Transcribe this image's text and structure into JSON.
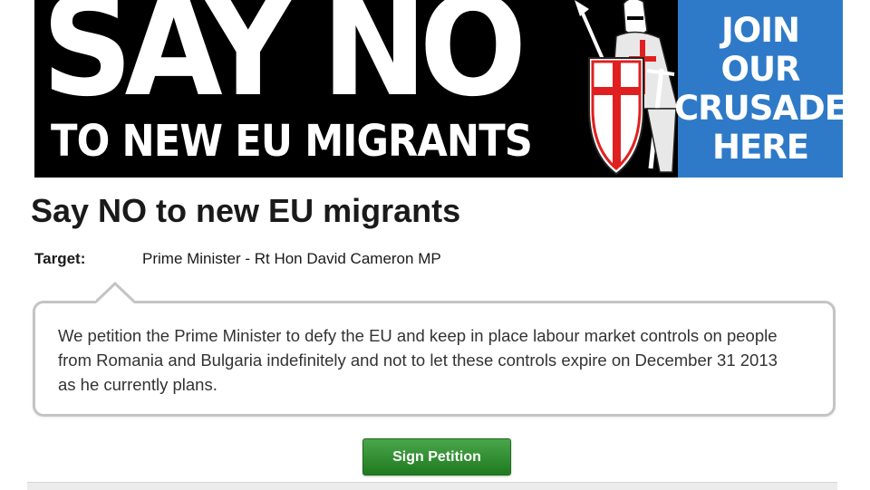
{
  "banner": {
    "headline": "SAY NO",
    "subheadline": "TO NEW EU MIGRANTS",
    "cta_lines": [
      "JOIN",
      "OUR",
      "CRUSADE",
      "HERE"
    ],
    "colors": {
      "background": "#000000",
      "cta_background": "#2f7ac8",
      "cross": "#e02020"
    },
    "icon": "crusader-knight-icon"
  },
  "petition": {
    "title": "Say NO to new EU migrants",
    "target_label": "Target:",
    "target_value": "Prime Minister - Rt Hon David Cameron MP",
    "body": "We petition the Prime Minister to defy the EU and keep in place labour market controls on people from Romania and Bulgaria indefinitely and not to let these controls expire on December 31 2013 as he currently plans.",
    "sign_button_label": "Sign Petition",
    "colors": {
      "sign_button": "#2e8b2e"
    }
  }
}
